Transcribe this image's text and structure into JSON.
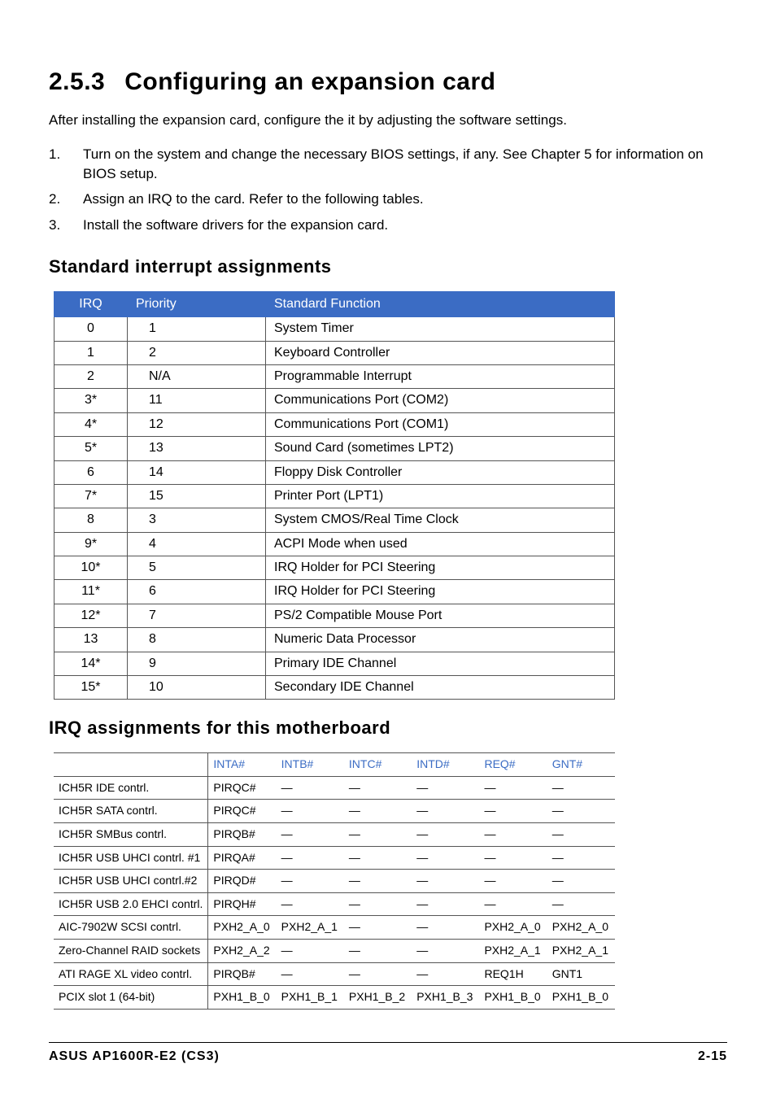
{
  "heading_num": "2.5.3",
  "heading_text": "Configuring an expansion card",
  "intro": "After installing the expansion card, configure the it by adjusting the software settings.",
  "steps": [
    "Turn on the system and change the necessary BIOS settings, if any. See Chapter 5 for information on BIOS setup.",
    "Assign an IRQ to the card. Refer to the following tables.",
    "Install the software drivers for the expansion card."
  ],
  "sia_heading": "Standard interrupt assignments",
  "sia_headers": [
    "IRQ",
    "Priority",
    "Standard Function"
  ],
  "sia_rows": [
    {
      "irq": "0",
      "pri": "1",
      "fn": "System Timer"
    },
    {
      "irq": "1",
      "pri": "2",
      "fn": "Keyboard Controller"
    },
    {
      "irq": "2",
      "pri": "N/A",
      "fn": "Programmable Interrupt"
    },
    {
      "irq": "3*",
      "pri": "11",
      "fn": "Communications Port (COM2)"
    },
    {
      "irq": "4*",
      "pri": "12",
      "fn": "Communications Port (COM1)"
    },
    {
      "irq": "5*",
      "pri": "13",
      "fn": "Sound Card (sometimes LPT2)"
    },
    {
      "irq": "6",
      "pri": "14",
      "fn": "Floppy Disk Controller"
    },
    {
      "irq": "7*",
      "pri": "15",
      "fn": "Printer Port (LPT1)"
    },
    {
      "irq": "8",
      "pri": "3",
      "fn": "System CMOS/Real Time Clock"
    },
    {
      "irq": "9*",
      "pri": "4",
      "fn": "ACPI Mode when used"
    },
    {
      "irq": "10*",
      "pri": "5",
      "fn": "IRQ Holder for PCI Steering"
    },
    {
      "irq": "11*",
      "pri": "6",
      "fn": "IRQ Holder for PCI Steering"
    },
    {
      "irq": "12*",
      "pri": "7",
      "fn": "PS/2 Compatible Mouse Port"
    },
    {
      "irq": "13",
      "pri": "8",
      "fn": "Numeric Data Processor"
    },
    {
      "irq": "14*",
      "pri": "9",
      "fn": "Primary IDE Channel"
    },
    {
      "irq": "15*",
      "pri": "10",
      "fn": "Secondary IDE Channel"
    }
  ],
  "mb_heading": "IRQ assignments for this motherboard",
  "mb_headers": [
    "",
    "INTA#",
    "INTB#",
    "INTC#",
    "INTD#",
    "REQ#",
    "GNT#"
  ],
  "mb_rows": [
    {
      "dev": "ICH5R IDE contrl.",
      "a": "PIRQC#",
      "b": "—",
      "c": "—",
      "d": "—",
      "r": "—",
      "g": "—"
    },
    {
      "dev": "ICH5R SATA contrl.",
      "a": "PIRQC#",
      "b": "—",
      "c": "—",
      "d": "—",
      "r": "—",
      "g": "—"
    },
    {
      "dev": "ICH5R SMBus contrl.",
      "a": "PIRQB#",
      "b": "—",
      "c": "—",
      "d": "—",
      "r": "—",
      "g": "—"
    },
    {
      "dev": "ICH5R USB UHCI contrl. #1",
      "a": "PIRQA#",
      "b": "—",
      "c": "—",
      "d": "—",
      "r": "—",
      "g": "—"
    },
    {
      "dev": "ICH5R USB UHCI contrl.#2",
      "a": "PIRQD#",
      "b": "—",
      "c": "—",
      "d": "—",
      "r": "—",
      "g": "—"
    },
    {
      "dev": "ICH5R USB 2.0 EHCI contrl.",
      "a": "PIRQH#",
      "b": "—",
      "c": "—",
      "d": "—",
      "r": "—",
      "g": "—"
    },
    {
      "dev": "AIC-7902W SCSI contrl.",
      "a": "PXH2_A_0",
      "b": "PXH2_A_1",
      "c": "—",
      "d": "—",
      "r": "PXH2_A_0",
      "g": "PXH2_A_0"
    },
    {
      "dev": "Zero-Channel RAID sockets",
      "a": "PXH2_A_2",
      "b": "—",
      "c": "—",
      "d": "—",
      "r": "PXH2_A_1",
      "g": "PXH2_A_1"
    },
    {
      "dev": "ATI RAGE XL video contrl.",
      "a": "PIRQB#",
      "b": "—",
      "c": "—",
      "d": "—",
      "r": "REQ1H",
      "g": "GNT1"
    },
    {
      "dev": "PCIX slot 1 (64-bit)",
      "a": "PXH1_B_0",
      "b": "PXH1_B_1",
      "c": "PXH1_B_2",
      "d": "PXH1_B_3",
      "r": "PXH1_B_0",
      "g": "PXH1_B_0"
    }
  ],
  "footer_left": "ASUS AP1600R-E2 (CS3)",
  "footer_right": "2-15"
}
